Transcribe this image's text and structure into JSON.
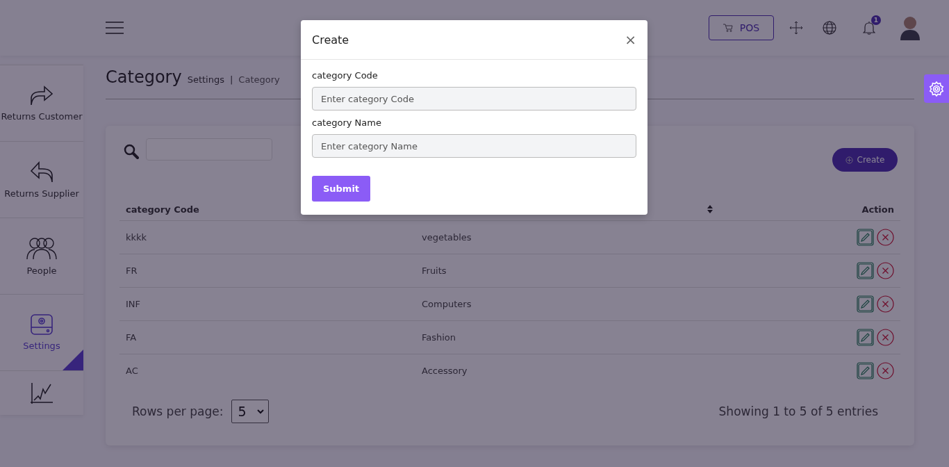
{
  "header": {
    "pos_button": "POS",
    "notification_count": "1"
  },
  "sidebar": {
    "items": [
      {
        "kind": "forward",
        "label": "Returns Customer",
        "selected": false
      },
      {
        "kind": "reply",
        "label": "Returns Supplier",
        "selected": false
      },
      {
        "kind": "people",
        "label": "People",
        "selected": false
      },
      {
        "kind": "settings",
        "label": "Settings",
        "selected": true
      },
      {
        "kind": "chart",
        "selected": false
      }
    ]
  },
  "page": {
    "title": "Category",
    "breadcrumb": [
      "Settings",
      "|",
      "Category"
    ]
  },
  "table": {
    "create_button": "Create",
    "columns": [
      {
        "label": "category Code"
      },
      {
        "sortable": true
      },
      {
        "label": "Action"
      }
    ],
    "rows": [
      {
        "code": "kkkk",
        "name": "vegetables"
      },
      {
        "code": "FR",
        "name": "Fruits"
      },
      {
        "code": "INF",
        "name": "Computers"
      },
      {
        "code": "FA",
        "name": "Fashion"
      },
      {
        "code": "AC",
        "name": "Accessory"
      }
    ],
    "rows_per_page_label": "Rows per page:",
    "rows_per_page": "5",
    "info": "Showing 1 to 5 of 5 entries"
  },
  "modal": {
    "title": "Create",
    "close": "×",
    "fields": [
      {
        "label": "category Code",
        "placeholder": "Enter category Code"
      },
      {
        "label": "category Name",
        "placeholder": "Enter category Name"
      }
    ],
    "submit": "Submit"
  }
}
